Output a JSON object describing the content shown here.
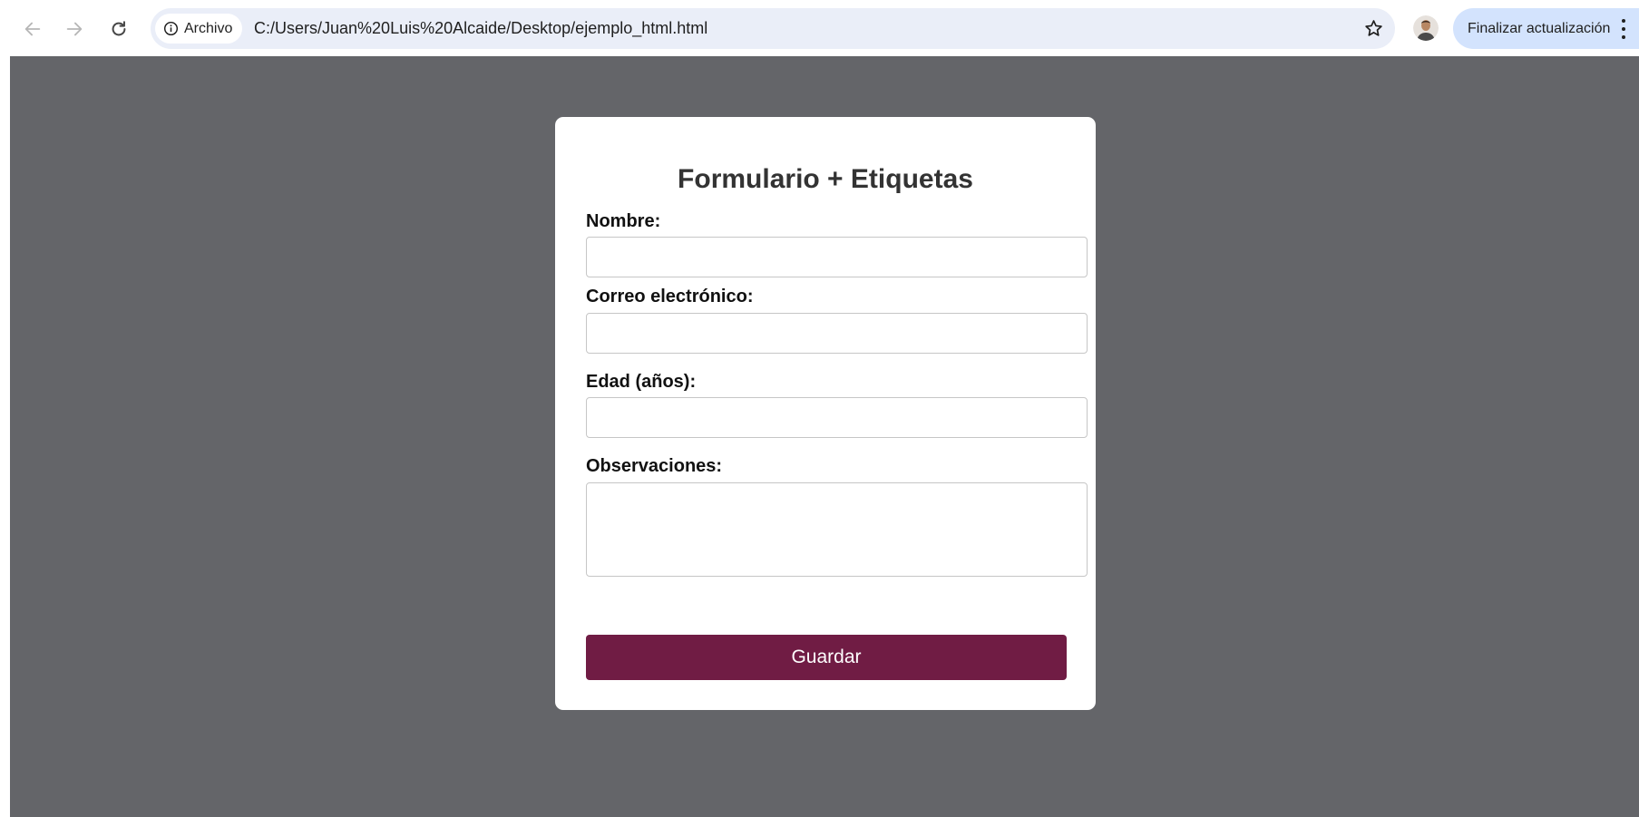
{
  "browser": {
    "nav": {
      "back_icon": "arrow-left-icon",
      "forward_icon": "arrow-right-icon",
      "reload_icon": "reload-icon"
    },
    "address_bar": {
      "security_icon": "info-icon",
      "security_label": "Archivo",
      "url": "C:/Users/Juan%20Luis%20Alcaide/Desktop/ejemplo_html.html",
      "bookmark_icon": "star-icon"
    },
    "profile_icon": "avatar",
    "update_button": {
      "label": "Finalizar actualización",
      "menu_icon": "kebab-menu-icon"
    }
  },
  "page": {
    "background_color": "#646569",
    "form": {
      "title": "Formulario + Etiquetas",
      "fields": [
        {
          "label": "Nombre:",
          "value": "",
          "type": "text"
        },
        {
          "label": "Correo electrónico:",
          "value": "",
          "type": "email"
        },
        {
          "label": "Edad (años):",
          "value": "",
          "type": "number"
        },
        {
          "label": "Observaciones:",
          "value": "",
          "type": "textarea"
        }
      ],
      "submit_label": "Guardar",
      "submit_color": "#701c44"
    }
  }
}
